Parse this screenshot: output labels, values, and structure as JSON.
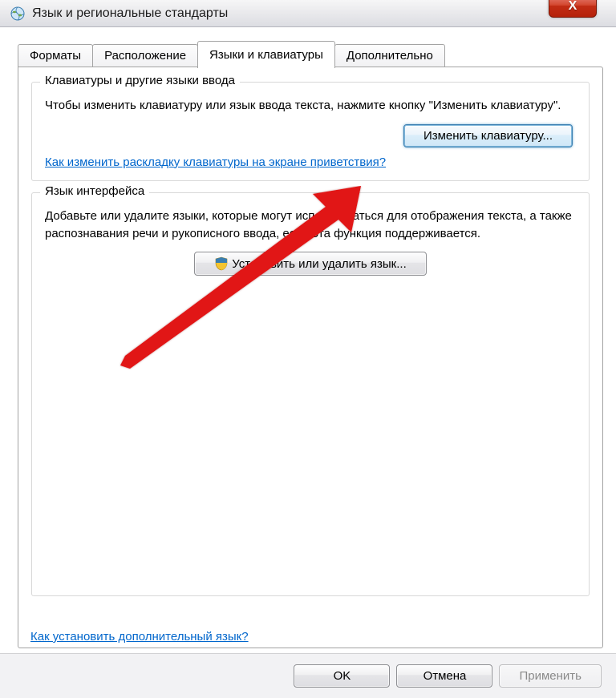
{
  "window": {
    "title": "Язык и региональные стандарты",
    "close_x": "X"
  },
  "tabs": {
    "formats": "Форматы",
    "location": "Расположение",
    "keyboards": "Языки и клавиатуры",
    "advanced": "Дополнительно"
  },
  "group1": {
    "legend": "Клавиатуры и другие языки ввода",
    "desc": "Чтобы изменить клавиатуру или язык ввода текста, нажмите кнопку \"Изменить клавиатуру\".",
    "button": "Изменить клавиатуру...",
    "link": "Как изменить раскладку клавиатуры на экране приветствия?"
  },
  "group2": {
    "legend": "Язык интерфейса",
    "desc": "Добавьте или удалите языки, которые могут использоваться для отображения текста, а также распознавания речи и рукописного ввода, если эта функция поддерживается.",
    "button": "Установить или удалить язык..."
  },
  "footer_link": "Как установить дополнительный язык?",
  "buttons": {
    "ok": "OK",
    "cancel": "Отмена",
    "apply": "Применить"
  }
}
